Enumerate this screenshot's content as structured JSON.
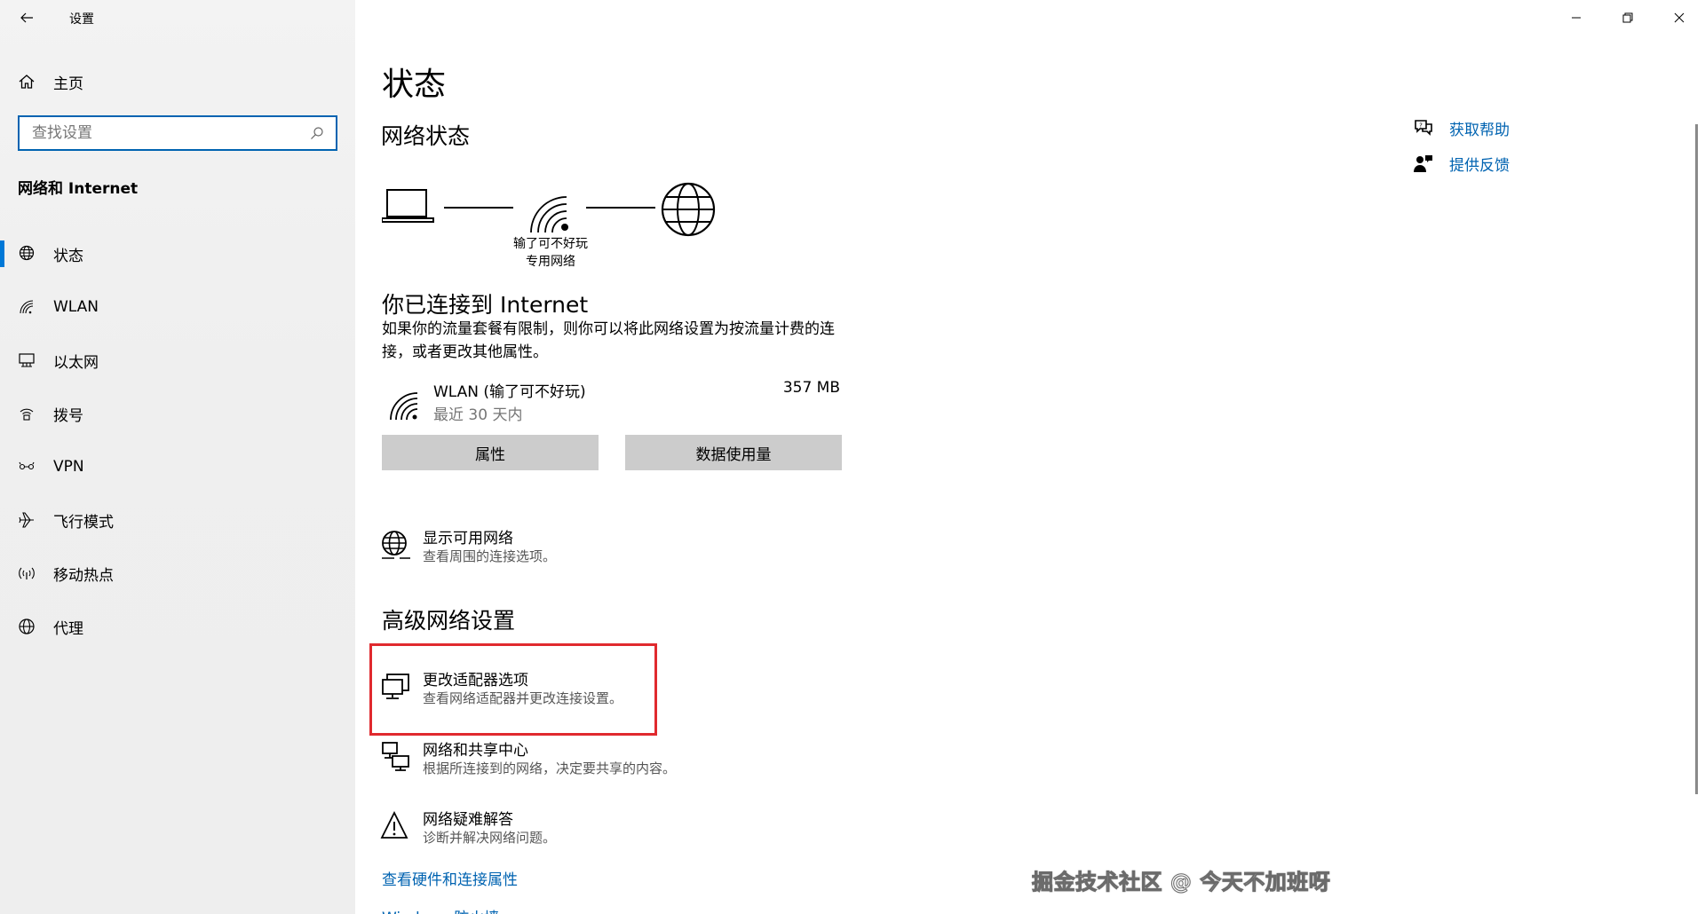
{
  "app": {
    "title": "设置"
  },
  "sidebar": {
    "home_label": "主页",
    "search_placeholder": "查找设置",
    "section_heading": "网络和 Internet",
    "items": [
      {
        "label": "状态",
        "icon": "globe-status-icon",
        "active": true
      },
      {
        "label": "WLAN",
        "icon": "wifi-icon"
      },
      {
        "label": "以太网",
        "icon": "ethernet-icon"
      },
      {
        "label": "拨号",
        "icon": "dialup-icon"
      },
      {
        "label": "VPN",
        "icon": "vpn-icon"
      },
      {
        "label": "飞行模式",
        "icon": "airplane-icon"
      },
      {
        "label": "移动热点",
        "icon": "hotspot-icon"
      },
      {
        "label": "代理",
        "icon": "proxy-globe-icon"
      }
    ]
  },
  "main": {
    "title": "状态",
    "network_status_heading": "网络状态",
    "diagram": {
      "network_name": "输了可不好玩",
      "network_type": "专用网络"
    },
    "connected_title": "你已连接到 Internet",
    "connected_desc": "如果你的流量套餐有限制，则你可以将此网络设置为按流量计费的连接，或者更改其他属性。",
    "connection": {
      "name": "WLAN (输了可不好玩)",
      "period": "最近 30 天内",
      "usage": "357 MB"
    },
    "buttons": {
      "properties": "属性",
      "data_usage": "数据使用量"
    },
    "show_networks": {
      "title": "显示可用网络",
      "subtitle": "查看周围的连接选项。"
    },
    "advanced_heading": "高级网络设置",
    "advanced_options": [
      {
        "title": "更改适配器选项",
        "subtitle": "查看网络适配器并更改连接设置。"
      },
      {
        "title": "网络和共享中心",
        "subtitle": "根据所连接到的网络，决定要共享的内容。"
      },
      {
        "title": "网络疑难解答",
        "subtitle": "诊断并解决网络问题。"
      }
    ],
    "links": {
      "hardware": "查看硬件和连接属性",
      "firewall": "Windows 防火墙"
    },
    "help": {
      "get_help": "获取帮助",
      "feedback": "提供反馈"
    }
  },
  "watermark": "掘金技术社区 @ 今天不加班呀",
  "colors": {
    "accent": "#0078d7",
    "link": "#0063b1",
    "highlight": "#e0292e",
    "button": "#cccccc"
  }
}
